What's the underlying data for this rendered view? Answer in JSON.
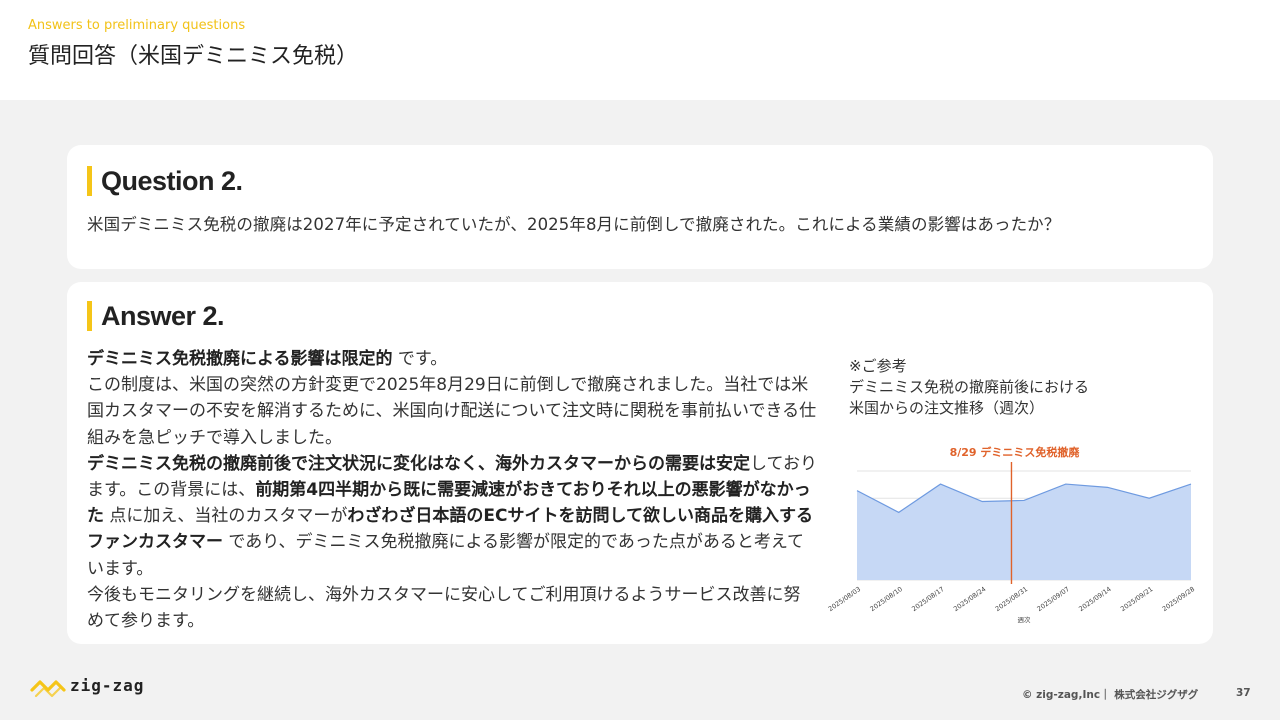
{
  "header": {
    "subtitle": "Answers to preliminary questions",
    "title": "質問回答（米国デミニミス免税）"
  },
  "question": {
    "heading": "Question 2.",
    "text": "米国デミニミス免税の撤廃は2027年に予定されていたが、2025年8月に前倒しで撤廃された。これによる業績の影響はあったか？"
  },
  "answer": {
    "heading": "Answer 2.",
    "segments": [
      {
        "text": "デミニミス免税撤廃による影響は限定的",
        "bold": true
      },
      {
        "text": " です。",
        "bold": false
      },
      {
        "text": "\n",
        "bold": false
      },
      {
        "text": "この制度は、米国の突然の方針変更で2025年8月29日に前倒しで撤廃されました。当社では米国カスタマーの不安を解消するために、米国向け配送について注文時に関税を事前払いできる仕組みを急ピッチで導入しました。",
        "bold": false
      },
      {
        "text": "\n",
        "bold": false
      },
      {
        "text": "デミニミス免税の撤廃前後で注文状況に変化はなく、海外カスタマーからの需要は安定",
        "bold": true
      },
      {
        "text": "しております。この背景には、",
        "bold": false
      },
      {
        "text": "前期第4四半期から既に需要減速がおきておりそれ以上の悪影響がなかった",
        "bold": true
      },
      {
        "text": " 点に加え、当社のカスタマーが",
        "bold": false
      },
      {
        "text": "わざわざ日本語のECサイトを訪問して欲しい商品を購入するファンカスタマー",
        "bold": true
      },
      {
        "text": " であり、デミニミス免税撤廃による影響が限定的であった点があると考えています。",
        "bold": false
      },
      {
        "text": "\n",
        "bold": false
      },
      {
        "text": "今後もモニタリングを継続し、海外カスタマーに安心してご利用頂けるようサービス改善に努めて参ります。",
        "bold": false
      }
    ]
  },
  "note": {
    "line1": "※ご参考",
    "line2": "デミニミス免税の撤廃前後における",
    "line3": "米国からの注文推移（週次）"
  },
  "chart_data": {
    "type": "area",
    "x": [
      "2025/08/03",
      "2025/08/10",
      "2025/08/17",
      "2025/08/24",
      "2025/08/31",
      "2025/09/07",
      "2025/09/14",
      "2025/09/21",
      "2025/09/28"
    ],
    "values": [
      0.82,
      0.62,
      0.88,
      0.72,
      0.73,
      0.88,
      0.85,
      0.75,
      0.88
    ],
    "xlabel": "週次",
    "ylabel": "",
    "annotation": {
      "label": "8/29 デミニミス免税撤廃",
      "x_index": 3.7
    },
    "fill_color": "#c6d8f5",
    "line_color": "#6e9ae0",
    "annotation_color": "#e0622a",
    "grid": true
  },
  "footer": {
    "logo_text": "zig-zag",
    "copyright": "© zig-zag,Inc｜ 株式会社ジグザグ",
    "page": "37"
  },
  "colors": {
    "accent": "#f5c518",
    "subtitle": "#f2c218"
  }
}
